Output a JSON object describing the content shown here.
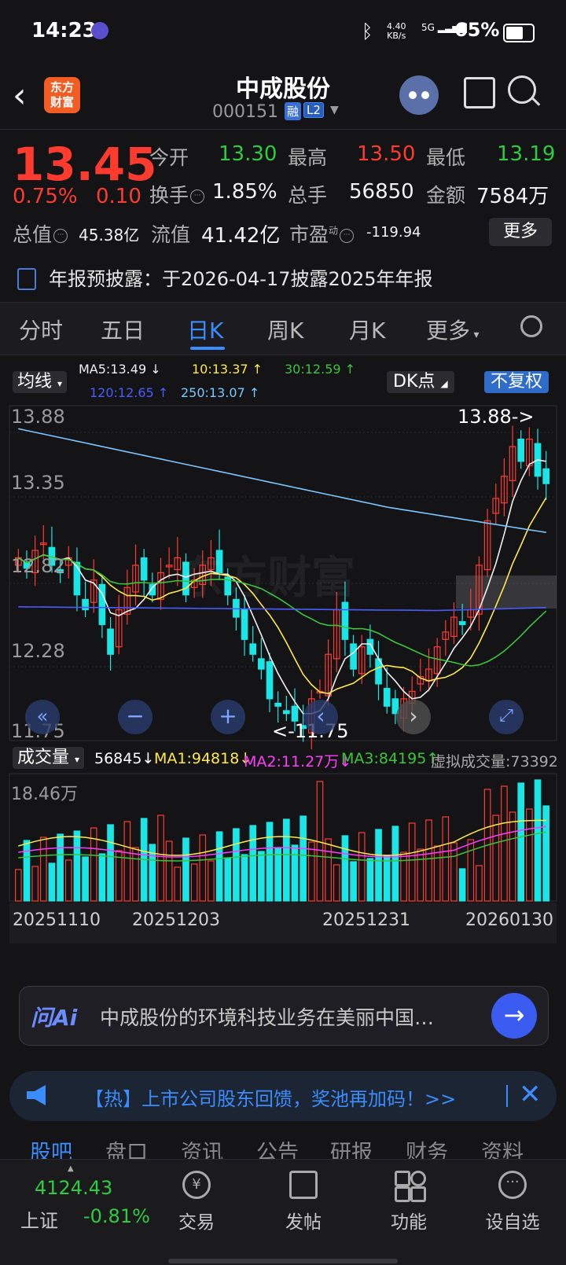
{
  "status": {
    "time": "14:23",
    "net_speed_top": "4.40",
    "net_speed_bottom": "KB/s",
    "signal": "5G",
    "battery_pct": "65%",
    "battery_level": 0.65
  },
  "header": {
    "back_icon": "chevron-left-icon",
    "logo_line1": "东方",
    "logo_line2": "财富",
    "stock_name": "中成股份",
    "stock_code": "000151",
    "tag_rong": "融",
    "tag_l2": "L2"
  },
  "quote": {
    "price": "13.45",
    "change_pct": "0.75%",
    "change_amt": "0.10",
    "open_label": "今开",
    "open": "13.30",
    "high_label": "最高",
    "high": "13.50",
    "low_label": "最低",
    "low": "13.19",
    "turnover_label": "换手",
    "turnover": "1.85%",
    "volume_label": "总手",
    "volume": "56850",
    "amount_label": "金额",
    "amount": "7584万",
    "mktcap_label": "总值",
    "mktcap": "45.38亿",
    "float_label": "流值",
    "float_cap": "41.42亿",
    "pe_label": "市盈",
    "pe_sup": "动",
    "pe": "-119.94",
    "more": "更多",
    "notice": "年报预披露：于2026-04-17披露2025年年报"
  },
  "tabs": [
    "分时",
    "五日",
    "日K",
    "周K",
    "月K",
    "更多"
  ],
  "active_tab": 2,
  "kline": {
    "ma_button": "均线",
    "ma5": "MA5:13.49 ↓",
    "ma10": "10:13.37 ↑",
    "ma30": "30:12.59 ↑",
    "ma120": "120:12.65 ↑",
    "ma250": "250:13.07 ↑",
    "dk": "DK点",
    "fq": "不复权",
    "y_labels": [
      "13.88",
      "13.35",
      "12.82",
      "12.28",
      "11.75"
    ],
    "max_label": "13.88->",
    "min_label": "<-11.75",
    "watermark": "东方财富",
    "vol_button": "成交量",
    "vol_val": "56845↓",
    "vol_ma1": "MA1:94818↓",
    "vol_ma2": "MA2:11.27万↓",
    "vol_ma3": "MA3:84195↑",
    "virtual_vol": "虚拟成交量:73392",
    "vol_max": "18.46万",
    "dates": [
      "20251110",
      "20251203",
      "20251231",
      "20260130"
    ]
  },
  "ai": {
    "logo": "问Ai",
    "prompt": "中成股份的环境科技业务在美丽中国…",
    "send_icon": "arrow-right-icon"
  },
  "promo": {
    "text": "【热】上市公司股东回馈，奖池再加码！>>",
    "close_icon": "close-icon"
  },
  "subtabs": [
    "股吧",
    "盘口",
    "资讯",
    "公告",
    "研报",
    "财务",
    "资料"
  ],
  "index": {
    "value": "4124.43",
    "name": "上证",
    "change": "-0.81%"
  },
  "bottom_nav": [
    "交易",
    "发帖",
    "功能",
    "设自选"
  ],
  "colors": {
    "up": "#ff3b30",
    "down": "#19e6e6",
    "accent": "#3a8cff"
  }
}
